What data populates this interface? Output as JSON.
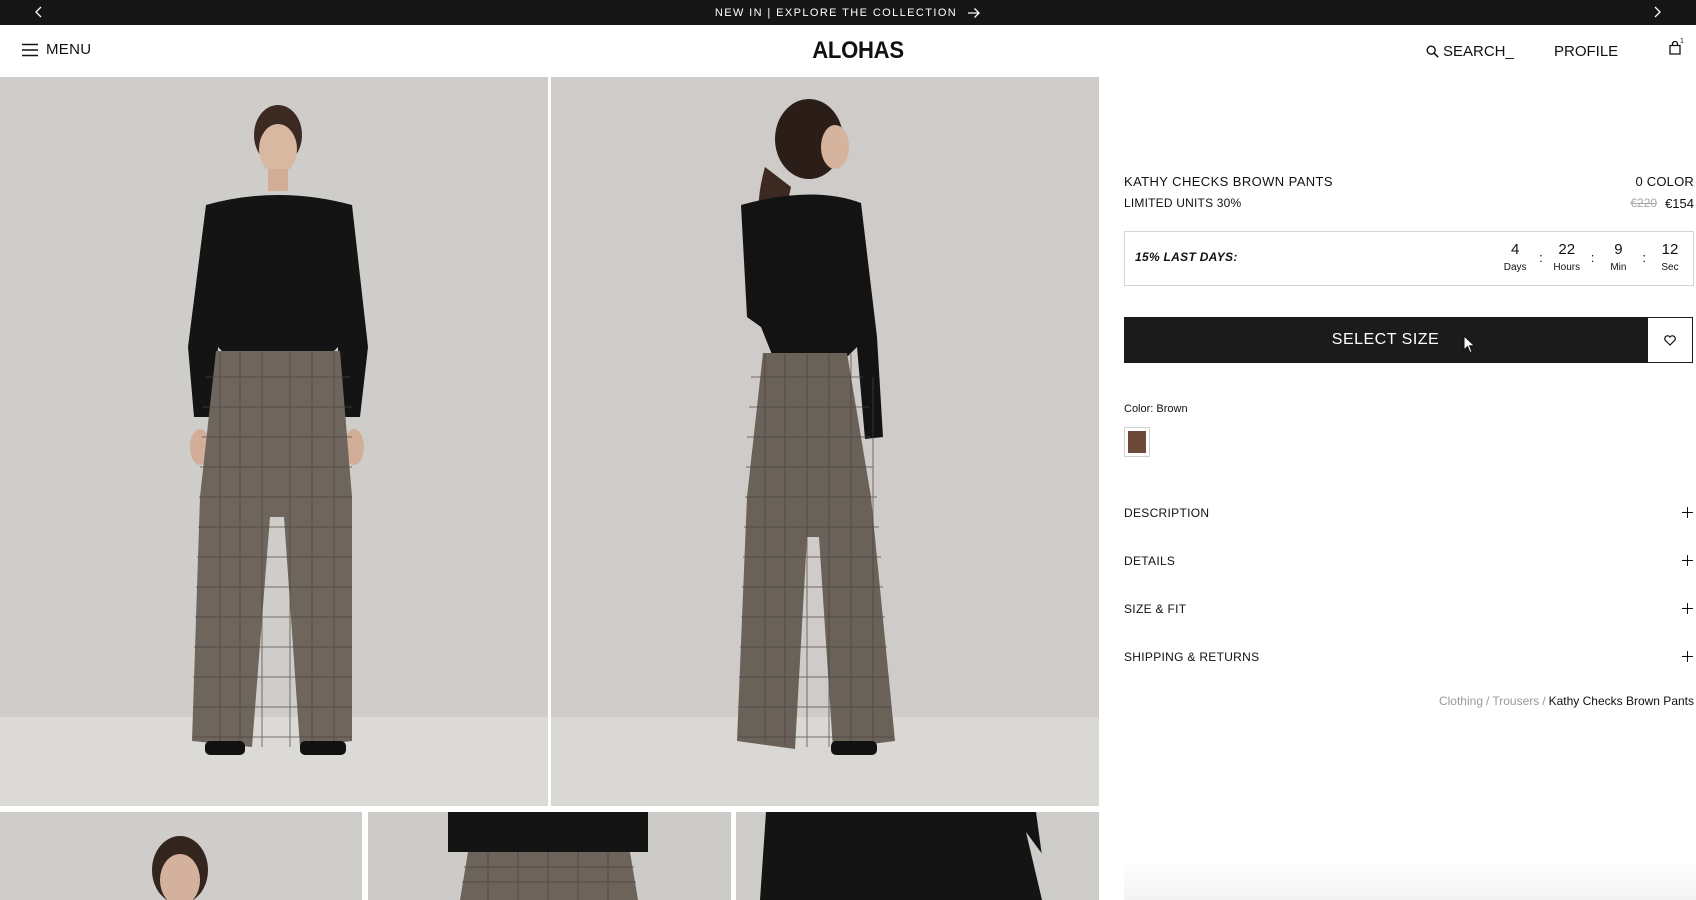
{
  "topbar": {
    "promo_text": "NEW IN | EXPLORE THE COLLECTION"
  },
  "header": {
    "menu_label": "MENU",
    "logo": "ALOHAS",
    "search_label": "SEARCH_",
    "profile_label": "PROFILE",
    "bag_count": "1"
  },
  "product": {
    "name": "KATHY CHECKS BROWN PANTS",
    "color_count": "0 COLOR",
    "badge": "LIMITED UNITS 30%",
    "price_old": "€220",
    "price_new": "€154"
  },
  "countdown": {
    "label": "15% LAST DAYS:",
    "units": [
      {
        "value": "4",
        "name": "Days"
      },
      {
        "value": "22",
        "name": "Hours"
      },
      {
        "value": "9",
        "name": "Min"
      },
      {
        "value": "12",
        "name": "Sec"
      }
    ],
    "separator": ":"
  },
  "actions": {
    "select_size_label": "SELECT SIZE"
  },
  "color": {
    "label": "Color: Brown",
    "swatch_hex": "#6b4a39"
  },
  "accordion": [
    {
      "label": "DESCRIPTION"
    },
    {
      "label": "DETAILS"
    },
    {
      "label": "SIZE & FIT"
    },
    {
      "label": "SHIPPING & RETURNS"
    }
  ],
  "breadcrumb": {
    "items": [
      "Clothing",
      "Trousers"
    ],
    "separator": "/",
    "current": "Kathy Checks Brown Pants"
  },
  "colors": {
    "topbar_bg": "#161616",
    "button_bg": "#1b1b1b",
    "image_bg": "#cfcdca"
  }
}
